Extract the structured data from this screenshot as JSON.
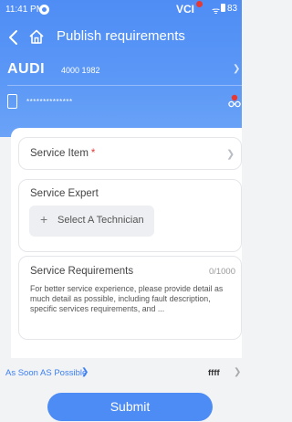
{
  "status_bar": {
    "time": "11:41 PM",
    "vci_label": "VCI",
    "battery_text": "83"
  },
  "header": {
    "title": "Publish requirements",
    "car_brand": "AUDI",
    "car_model": "4000 1982",
    "serial_masked": "**************",
    "colors": {
      "accent": "#4f8df5",
      "alert": "#e53935"
    }
  },
  "form": {
    "service_item": {
      "label": "Service Item",
      "required_mark": "*"
    },
    "service_expert": {
      "label": "Service Expert",
      "button_label": "Select A Technician"
    },
    "service_requirements": {
      "label": "Service Requirements",
      "counter": "0/1000",
      "placeholder": "For better service experience, please provide detail as much detail as possible, including fault description, specific services requirements, and ..."
    }
  },
  "footer": {
    "time_option": "As Soon AS Possible",
    "right_value": "ffff",
    "submit_label": "Submit"
  },
  "icons": [
    "back-icon",
    "home-icon",
    "device-icon",
    "link-icon",
    "chevron-right-icon",
    "plus-icon"
  ]
}
